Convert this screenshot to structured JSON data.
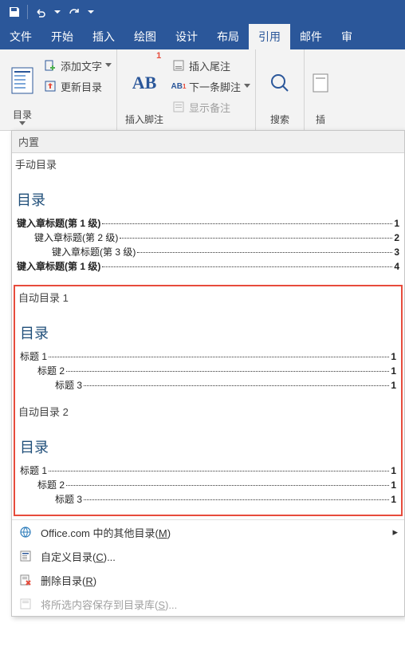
{
  "titlebar": {
    "save": "save",
    "undo": "undo",
    "redo": "redo"
  },
  "tabs": {
    "file": "文件",
    "home": "开始",
    "insert": "插入",
    "draw": "绘图",
    "design": "设计",
    "layout": "布局",
    "references": "引用",
    "mailings": "邮件",
    "review": "审"
  },
  "ribbon": {
    "toc_btn": "目录",
    "add_text": "添加文字",
    "update_toc": "更新目录",
    "insert_footnote": "插入脚注",
    "ab_badge": "1",
    "insert_endnote": "插入尾注",
    "next_footnote": "下一条脚注",
    "show_notes": "显示备注",
    "search": "搜索",
    "insert_trunc": "插"
  },
  "dropdown": {
    "builtin": "内置",
    "manual_title": "手动目录",
    "preview_heading": "目录",
    "manual": {
      "l1a": "键入章标题(第 1 级)",
      "p1a": "1",
      "l2": "键入章标题(第 2 级)",
      "p2": "2",
      "l3": "键入章标题(第 3 级)",
      "p3": "3",
      "l1b": "键入章标题(第 1 级)",
      "p1b": "4"
    },
    "auto1_title": "自动目录 1",
    "auto1": {
      "l1": "标题 1",
      "p1": "1",
      "l2": "标题 2",
      "p2": "1",
      "l3": "标题 3",
      "p3": "1"
    },
    "auto2_title": "自动目录 2",
    "auto2": {
      "l1": "标题 1",
      "p1": "1",
      "l2": "标题 2",
      "p2": "1",
      "l3": "标题 3",
      "p3": "1"
    },
    "more_office": "Office.com 中的其他目录(",
    "more_office_u": "M",
    "more_office_end": ")",
    "custom": "自定义目录(",
    "custom_u": "C",
    "custom_end": ")...",
    "remove": "删除目录(",
    "remove_u": "R",
    "remove_end": ")",
    "save_selection": "将所选内容保存到目录库(",
    "save_selection_u": "S",
    "save_selection_end": ")..."
  }
}
